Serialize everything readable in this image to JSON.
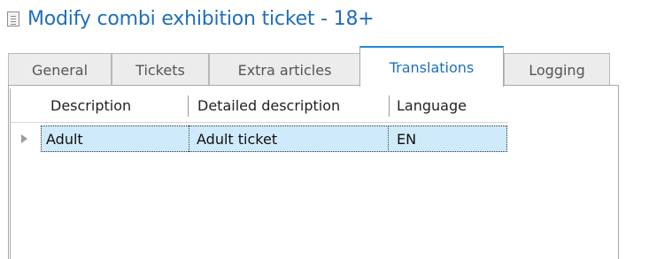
{
  "window": {
    "title": "Modify combi exhibition ticket  - 18+",
    "icon": "document-icon",
    "title_color": "#1f6fb8"
  },
  "tabs": [
    {
      "label": "General",
      "active": false
    },
    {
      "label": "Tickets",
      "active": false
    },
    {
      "label": "Extra articles",
      "active": false
    },
    {
      "label": "Translations",
      "active": true
    },
    {
      "label": "Logging",
      "active": false
    }
  ],
  "grid": {
    "columns": [
      "Description",
      "Detailed description",
      "Language"
    ],
    "rows": [
      {
        "description": "Adult",
        "detailed_description": "Adult ticket",
        "language": "EN",
        "selected": true
      }
    ],
    "selection_color": "#cfeafb",
    "active_tab_accent": "#1e88d4"
  }
}
